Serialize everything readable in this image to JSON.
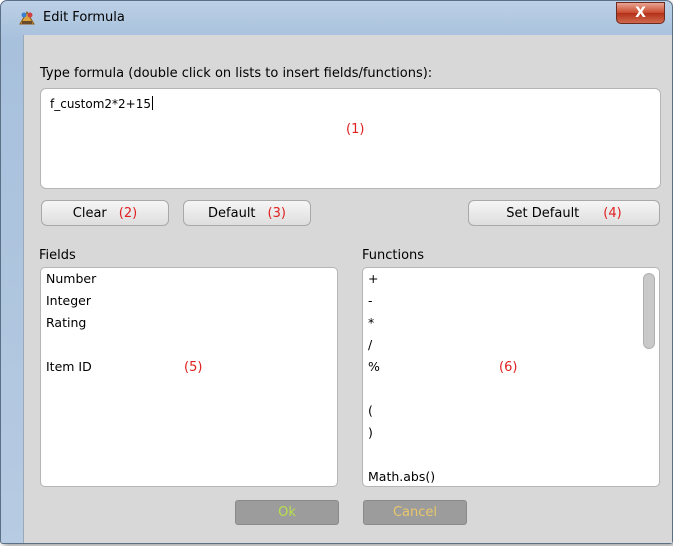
{
  "window": {
    "title": "Edit Formula",
    "close_glyph": "X"
  },
  "formula": {
    "label": "Type formula (double click on lists to insert fields/functions):",
    "value": "f_custom2*2+15",
    "annotation": "(1)"
  },
  "buttons": {
    "clear": {
      "label": "Clear",
      "annotation": "(2)"
    },
    "default": {
      "label": "Default",
      "annotation": "(3)"
    },
    "set_default": {
      "label": "Set Default",
      "annotation": "(4)"
    }
  },
  "fields": {
    "label": "Fields",
    "items": [
      "Number",
      "Integer",
      "Rating",
      "",
      "Item ID"
    ],
    "annotation": "(5)"
  },
  "functions": {
    "label": "Functions",
    "items": [
      "+",
      "-",
      "*",
      "/",
      "%",
      "",
      "(",
      ")",
      "",
      "Math.abs()"
    ],
    "annotation": "(6)"
  },
  "dialog": {
    "ok": "Ok",
    "cancel": "Cancel",
    "ok_color": "#b8e04a",
    "cancel_color": "#e8c86a"
  },
  "colors": {
    "annotation": "#e02020"
  }
}
